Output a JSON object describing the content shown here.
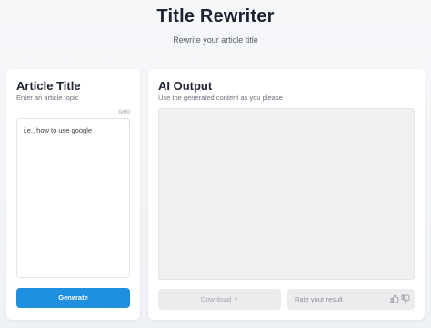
{
  "header": {
    "title": "Title Rewriter",
    "subtitle": "Rewrite your article title"
  },
  "input_panel": {
    "title": "Article Title",
    "subtitle": "Enter an article topic",
    "counter": "0/60",
    "placeholder": "i.e., how to use google",
    "value": "",
    "generate_label": "Generate"
  },
  "output_panel": {
    "title": "AI Output",
    "subtitle": "Use the generated content as you please",
    "download_label": "Download",
    "rate_label": "Rate your result"
  },
  "icons": {
    "thumbs_up": "thumbs-up-icon",
    "thumbs_down": "thumbs-down-icon",
    "download_caret": "chevron-down-icon"
  },
  "colors": {
    "accent": "#1f8fe0",
    "title_text": "#1d2333",
    "background": "#eef1f5"
  }
}
